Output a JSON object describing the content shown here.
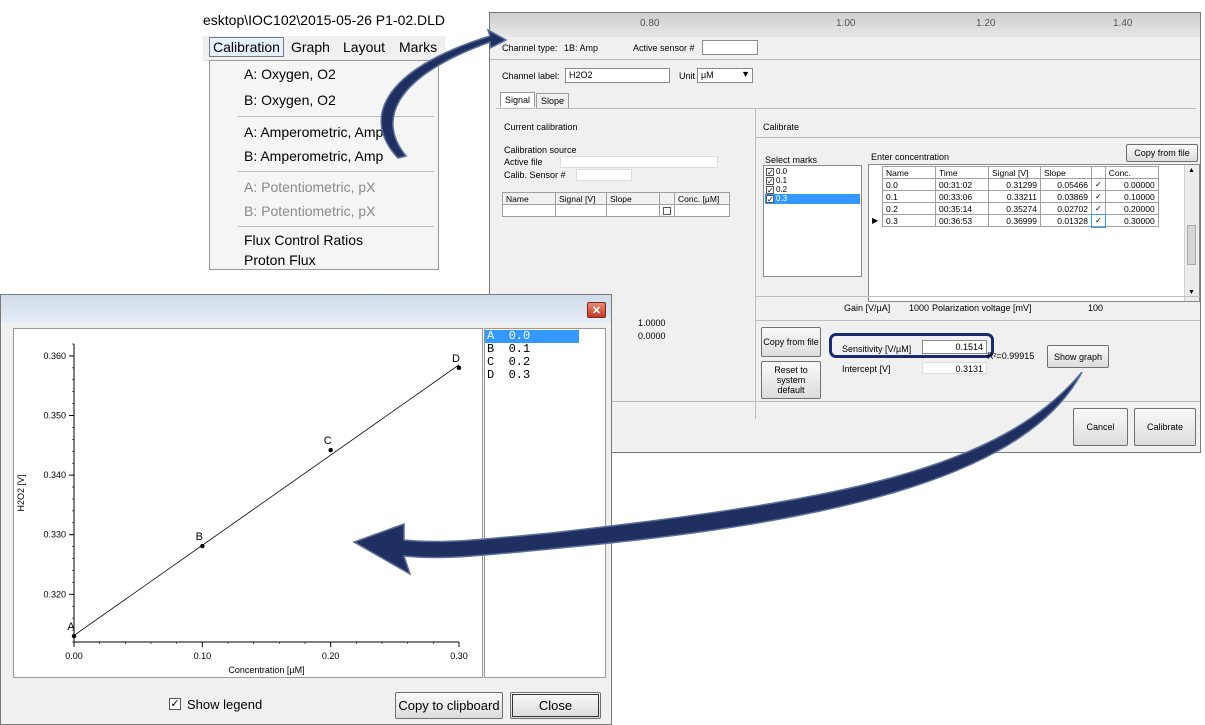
{
  "menu": {
    "path": "esktop\\IOC102\\2015-05-26 P1-02.DLD",
    "bar": [
      "Calibration",
      "Graph",
      "Layout",
      "Marks"
    ],
    "items": [
      "A: Oxygen, O2",
      "B: Oxygen, O2",
      "A: Amperometric, Amp",
      "B: Amperometric, Amp",
      "A: Potentiometric, pX",
      "B: Potentiometric, pX",
      "Flux Control Ratios",
      "Proton Flux"
    ]
  },
  "calib": {
    "ruler": [
      "0.80",
      "1.00",
      "1.20",
      "1.40"
    ],
    "channel_type_label": "Channel type:",
    "channel_type_value": "1B: Amp",
    "active_sensor_label": "Active sensor #",
    "channel_label_label": "Channel label:",
    "channel_label_value": "H2O2",
    "unit_label": "Unit",
    "unit_value": "µM",
    "tabs": [
      "Signal",
      "Slope"
    ],
    "current_calibration": "Current calibration",
    "calibration_source": "Calibration source",
    "active_file": "Active file",
    "calib_sensor": "Calib. Sensor #",
    "left_headers": [
      "Name",
      "Signal [V]",
      "Slope",
      "",
      "Conc. [µM]"
    ],
    "left_values": [
      "1.0000",
      "0.0000"
    ],
    "calibrate_title": "Calibrate",
    "select_marks": "Select marks",
    "marks": [
      "0.0",
      "0.1",
      "0.2",
      "0.3"
    ],
    "enter_concentration": "Enter concentration",
    "copy_from_file": "Copy from file",
    "table_headers": [
      "Name",
      "Time",
      "Signal [V]",
      "Slope",
      "",
      "Conc."
    ],
    "rows": [
      {
        "name": "0.0",
        "time": "00:31:02",
        "signal": "0.31299",
        "slope": "0.05466",
        "conc": "0.00000"
      },
      {
        "name": "0.1",
        "time": "00:33:06",
        "signal": "0.33211",
        "slope": "0.03869",
        "conc": "0.10000"
      },
      {
        "name": "0.2",
        "time": "00:35:14",
        "signal": "0.35274",
        "slope": "0.02702",
        "conc": "0.20000"
      },
      {
        "name": "0.3",
        "time": "00:36:53",
        "signal": "0.36999",
        "slope": "0.01328",
        "conc": "0.30000"
      }
    ],
    "gain_label": "Gain [V/µA]",
    "gain_value": "1000",
    "polarization_label": "Polarization voltage [mV]",
    "polarization_value": "100",
    "copy_from_file_btn": "Copy from file",
    "reset_btn": "Reset to system default",
    "sensitivity_label": "Sensitivity [V/µM]",
    "sensitivity_value": "0.1514",
    "intercept_label": "Intercept [V]",
    "intercept_value": "0.3131",
    "r2": "R²=0.99915",
    "show_graph": "Show graph",
    "cancel": "Cancel",
    "calibrate_btn": "Calibrate"
  },
  "graph_window": {
    "show_legend": "Show legend",
    "copy_clipboard": "Copy to clipboard",
    "close": "Close",
    "legend": [
      "A  0.0",
      "B  0.1",
      "C  0.2",
      "D  0.3"
    ]
  },
  "chart_data": {
    "type": "scatter",
    "title": "",
    "xlabel": "Concentration [µM]",
    "ylabel": "H2O2 [V]",
    "xlim": [
      0.0,
      0.3
    ],
    "ylim": [
      0.312,
      0.362
    ],
    "xticks": [
      "0.00",
      "0.10",
      "0.20",
      "0.30"
    ],
    "yticks": [
      "0.320",
      "0.330",
      "0.340",
      "0.350",
      "0.360"
    ],
    "points": [
      {
        "label": "A",
        "x": 0.0,
        "y": 0.313
      },
      {
        "label": "B",
        "x": 0.1,
        "y": 0.3281
      },
      {
        "label": "C",
        "x": 0.2,
        "y": 0.3442
      },
      {
        "label": "D",
        "x": 0.3,
        "y": 0.358
      }
    ],
    "fit_line": {
      "x": [
        0.0,
        0.3
      ],
      "y": [
        0.3131,
        0.3585
      ]
    },
    "grid": false,
    "legend_position": "right"
  }
}
